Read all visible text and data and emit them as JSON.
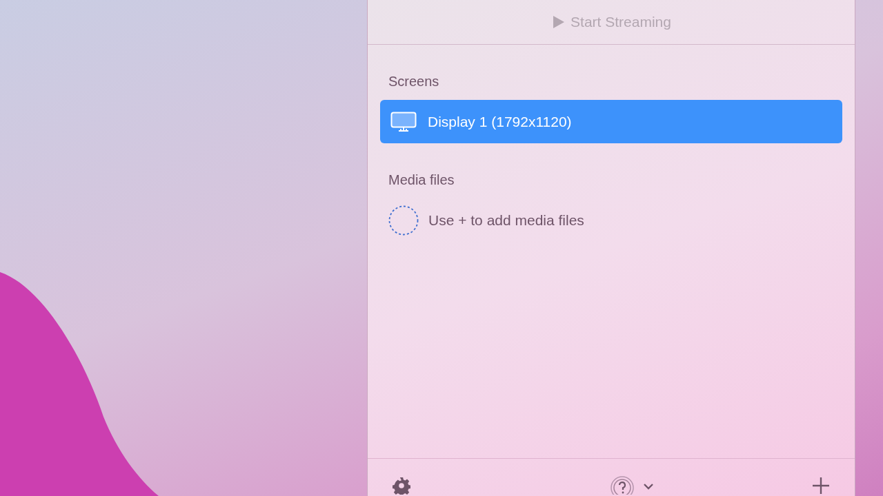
{
  "start_button": {
    "label": "Start Streaming",
    "disabled": true
  },
  "sections": [
    {
      "title": "Screens",
      "items": [
        {
          "kind": "display",
          "label": "Display 1 (1792x1120)",
          "selected": true
        }
      ]
    },
    {
      "title": "Media files",
      "items": [
        {
          "kind": "empty-hint",
          "label": "Use + to add media files"
        }
      ]
    }
  ]
}
